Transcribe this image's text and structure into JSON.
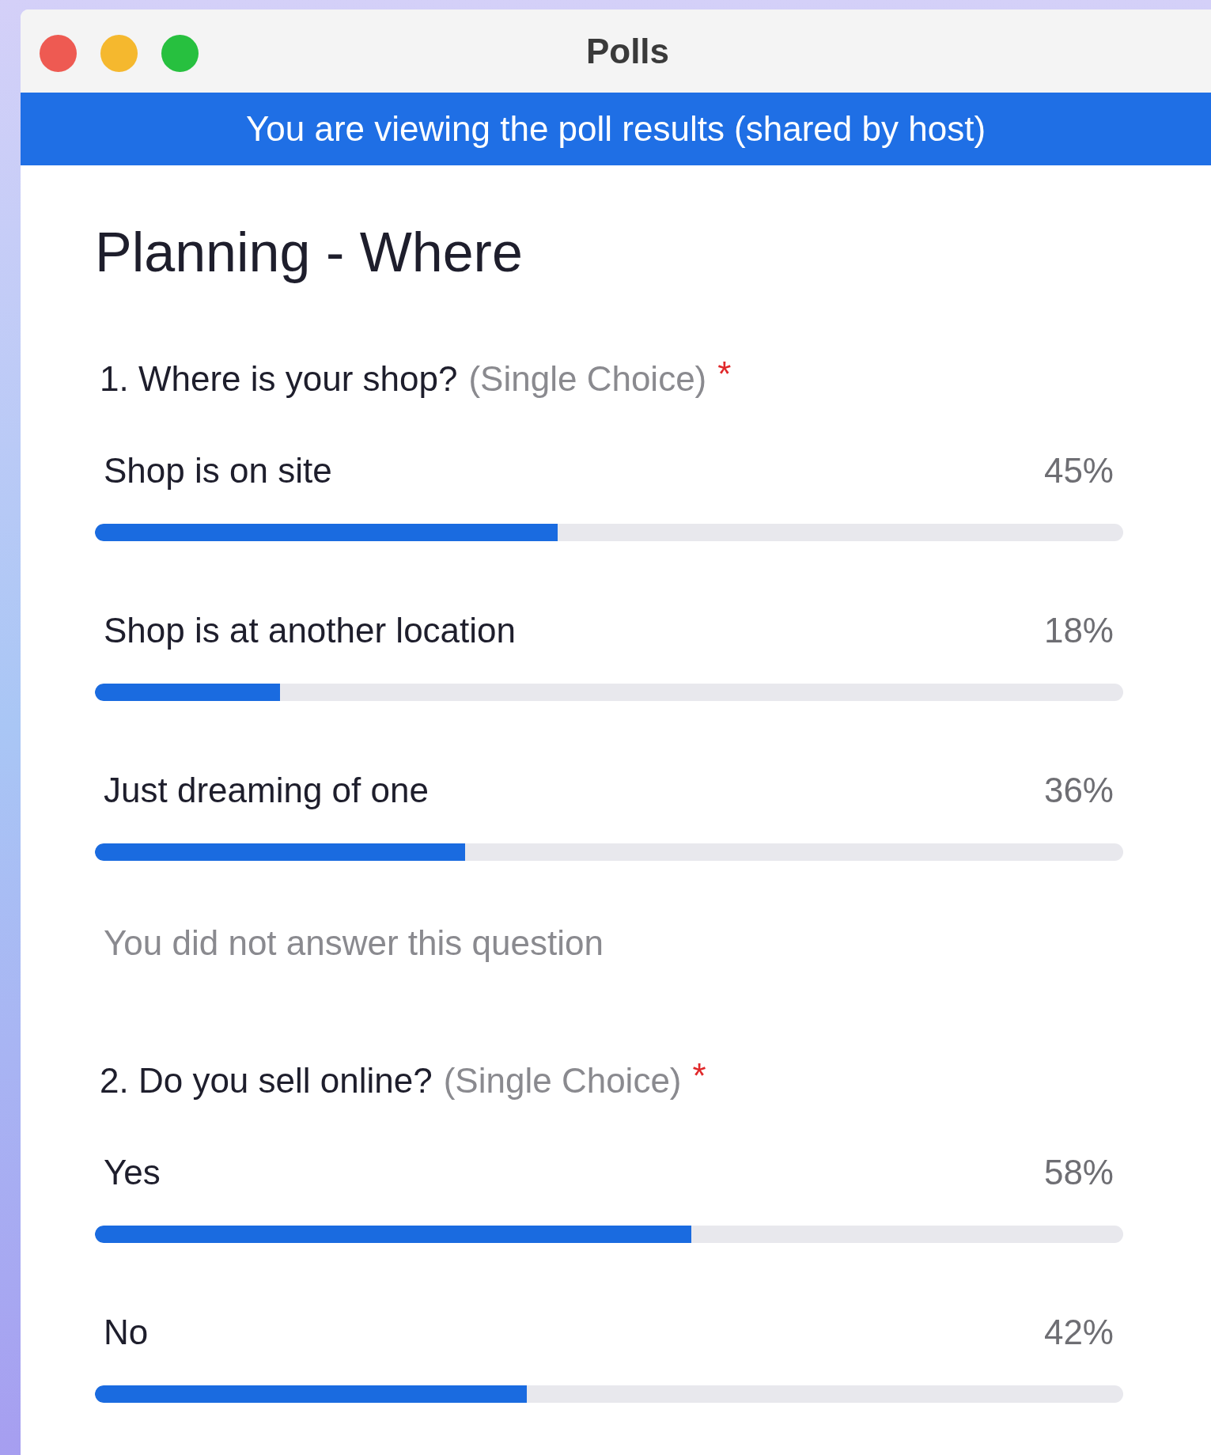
{
  "window": {
    "title": "Polls"
  },
  "banner": "You are viewing the poll results (shared by host)",
  "poll_title": "Planning - Where",
  "questions": [
    {
      "text": "1. Where is your shop?",
      "type": "(Single Choice)",
      "required_mark": "*",
      "options": [
        {
          "label": "Shop is on site",
          "percent": "45%",
          "level": 0.45
        },
        {
          "label": "Shop is at another location",
          "percent": "18%",
          "level": 0.18
        },
        {
          "label": "Just dreaming of one",
          "percent": "36%",
          "level": 0.36
        }
      ],
      "note": "You did not answer this question"
    },
    {
      "text": "2. Do you sell online?",
      "type": "(Single Choice)",
      "required_mark": "*",
      "options": [
        {
          "label": "Yes",
          "percent": "58%",
          "level": 0.58
        },
        {
          "label": "No",
          "percent": "42%",
          "level": 0.42
        }
      ]
    }
  ]
}
